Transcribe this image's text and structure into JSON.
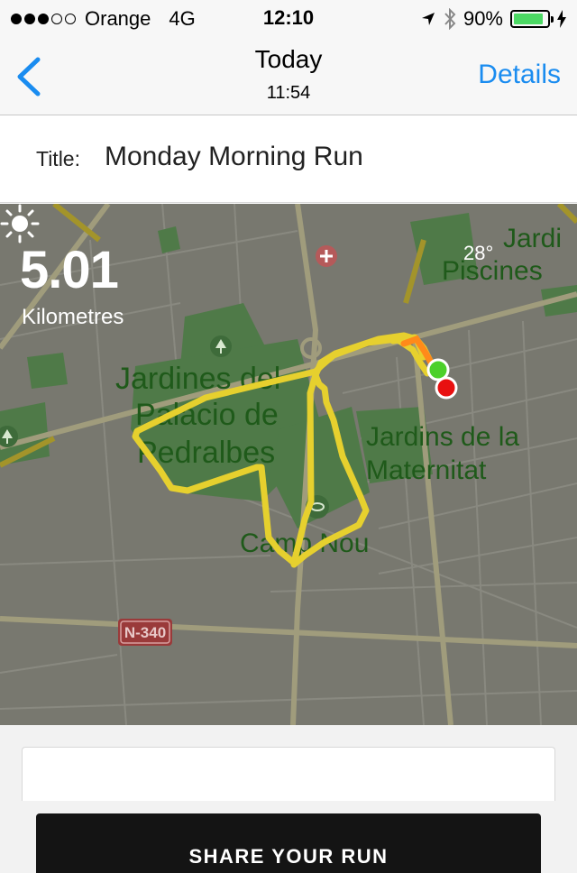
{
  "status_bar": {
    "carrier": "Orange",
    "network": "4G",
    "time": "12:10",
    "battery_percent": "90%",
    "battery_level": 0.9,
    "signal_bars": 3,
    "signal_total": 5,
    "icons": [
      "location-arrow-icon",
      "bluetooth-icon",
      "battery-icon"
    ]
  },
  "nav": {
    "back_icon": "chevron-left-icon",
    "title": "Today",
    "subtitle": "11:54",
    "details_label": "Details"
  },
  "run": {
    "title_label": "Title:",
    "title_value": "Monday Morning Run",
    "distance": "5.01",
    "distance_unit": "Kilometres",
    "temperature": "28°",
    "weather_icon": "sun-icon"
  },
  "map": {
    "labels": {
      "jardines_1": "Jardines del",
      "jardines_2": "Palacio de",
      "jardines_3": "Pedralbes",
      "maternitat_1": "Jardins de la",
      "maternitat_2": "Maternitat",
      "camp_nou": "Camp Nou",
      "piscines_1": "Jardi",
      "piscines_2": "Piscines",
      "road_shield": "N-340"
    },
    "colors": {
      "route": "#e6d02e",
      "route_end": "#ff8a1a",
      "start_marker": "#4cd02a",
      "end_marker": "#e81010",
      "park": "#4f7a48",
      "label": "#1f5a1a"
    }
  },
  "share": {
    "button_label": "SHARE YOUR RUN"
  }
}
